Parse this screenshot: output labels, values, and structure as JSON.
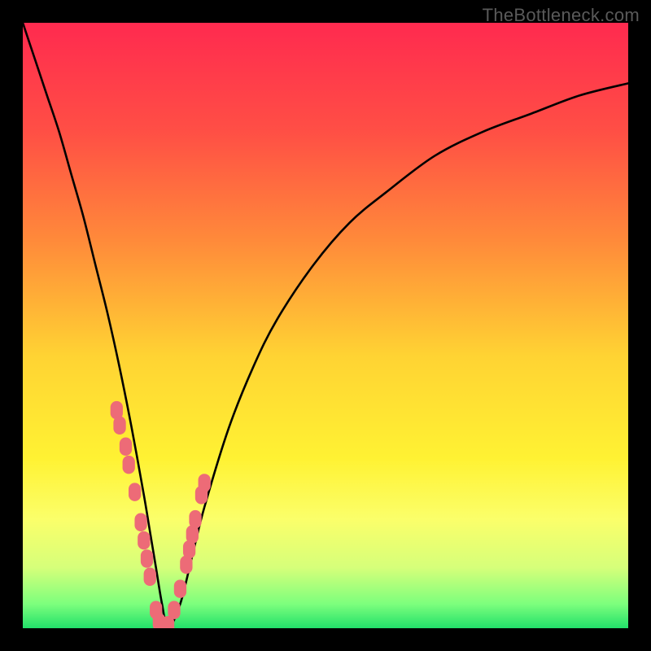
{
  "watermark": "TheBottleneck.com",
  "gradient": {
    "stops": [
      {
        "offset": 0.0,
        "color": "#ff2a4f"
      },
      {
        "offset": 0.18,
        "color": "#ff4f45"
      },
      {
        "offset": 0.36,
        "color": "#ff8a3a"
      },
      {
        "offset": 0.55,
        "color": "#ffd333"
      },
      {
        "offset": 0.72,
        "color": "#fff233"
      },
      {
        "offset": 0.82,
        "color": "#fbff6a"
      },
      {
        "offset": 0.9,
        "color": "#d6ff7a"
      },
      {
        "offset": 0.96,
        "color": "#7dff7d"
      },
      {
        "offset": 1.0,
        "color": "#22e06a"
      }
    ]
  },
  "chart_data": {
    "type": "line",
    "title": "",
    "xlabel": "",
    "ylabel": "",
    "xlim": [
      0,
      100
    ],
    "ylim": [
      0,
      100
    ],
    "series": [
      {
        "name": "bottleneck-curve",
        "x": [
          0,
          2,
          4,
          6,
          8,
          10,
          12,
          14,
          16,
          18,
          20,
          21,
          22,
          23,
          24,
          26,
          28,
          30,
          34,
          38,
          42,
          48,
          54,
          60,
          68,
          76,
          84,
          92,
          100
        ],
        "y": [
          100,
          94,
          88,
          82,
          75,
          68,
          60,
          52,
          43,
          33,
          22,
          16,
          10,
          4,
          0,
          4,
          12,
          20,
          33,
          43,
          51,
          60,
          67,
          72,
          78,
          82,
          85,
          88,
          90
        ]
      }
    ],
    "markers": {
      "name": "highlight-points",
      "color": "#ed6b77",
      "radius_px": 9,
      "x": [
        15.5,
        16.0,
        17.0,
        17.5,
        18.5,
        19.5,
        20.0,
        20.5,
        21.0,
        22.0,
        22.5,
        23.0,
        24.0,
        25.0,
        26.0,
        27.0,
        27.5,
        28.0,
        28.5,
        29.5,
        30.0
      ],
      "y": [
        36.0,
        33.5,
        30.0,
        27.0,
        22.5,
        17.5,
        14.5,
        11.5,
        8.5,
        3.0,
        1.0,
        0.0,
        0.5,
        3.0,
        6.5,
        10.5,
        13.0,
        15.5,
        18.0,
        22.0,
        24.0
      ]
    }
  }
}
